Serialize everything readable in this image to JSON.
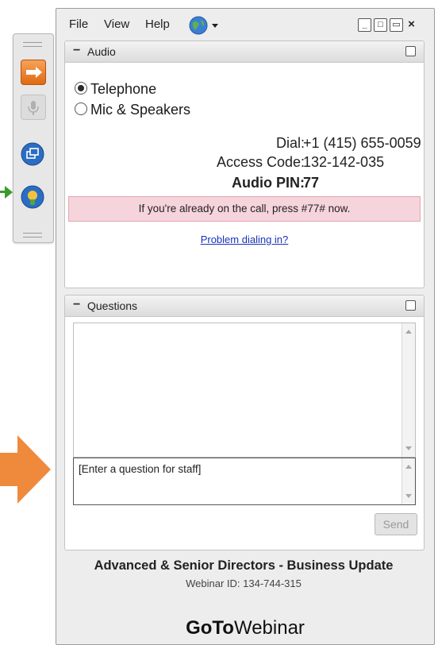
{
  "menu": {
    "file": "File",
    "view": "View",
    "help": "Help"
  },
  "window_controls": {
    "minimize": "_",
    "maximize": "□",
    "restore": "▭",
    "close": "×"
  },
  "audio": {
    "title": "Audio",
    "collapse": "−",
    "telephone_label": "Telephone",
    "mic_label": "Mic & Speakers",
    "selected": "Telephone",
    "dial_label": "Dial:",
    "dial_value": "+1 (415) 655-0059",
    "access_label": "Access Code:",
    "access_value": "132-142-035",
    "pin_label": "Audio PIN:",
    "pin_value": "77",
    "notice": "If you're already on the call, press #77# now.",
    "problem_link": "Problem dialing in?"
  },
  "questions": {
    "title": "Questions",
    "collapse": "−",
    "input_placeholder": "[Enter a question for staff]",
    "send_label": "Send"
  },
  "session": {
    "title": "Advanced & Senior Directors - Business Update",
    "webinar_id": "Webinar ID: 134-744-315"
  },
  "brand": {
    "bold": "GoTo",
    "regular": "Webinar"
  },
  "colors": {
    "hand_button": "#e97a22",
    "notice_bg": "#f6d4dc",
    "link": "#1a33b8",
    "green_arrow": "#3c9a2e",
    "orange_arrow": "#ef8a3d"
  }
}
